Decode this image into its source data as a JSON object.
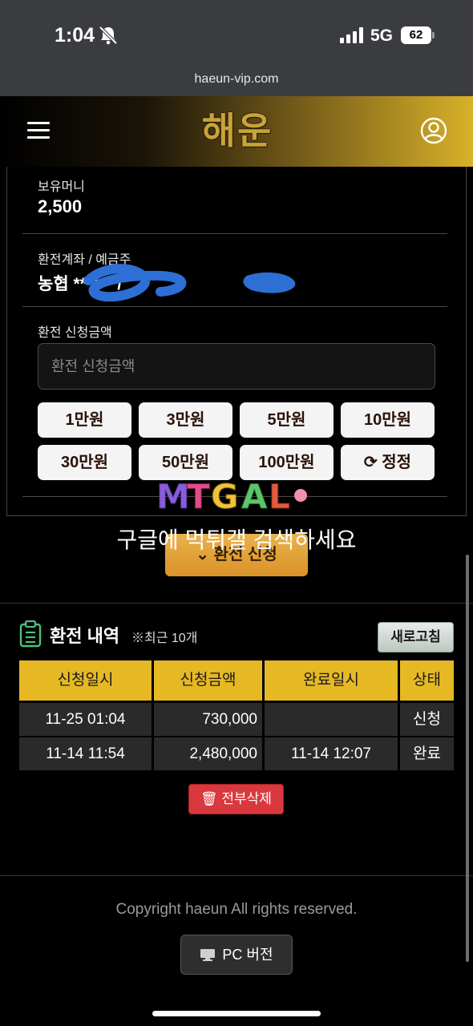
{
  "status_bar": {
    "time": "1:04",
    "network": "5G",
    "battery": "62",
    "icons": [
      "bell-slash-icon",
      "signal-icon",
      "battery-icon"
    ]
  },
  "browser": {
    "url": "haeun-vip.com"
  },
  "header": {
    "logo_text": "해운",
    "menu_icon": "hamburger-icon",
    "user_icon": "user-circle-icon",
    "accent_color": "#d9b128"
  },
  "form": {
    "balance_label": "보유머니",
    "balance_value": "2,500",
    "account_label": "환전계좌 / 예금주",
    "account_value": "농협 ****** / ",
    "amount_label": "환전 신청금액",
    "amount_placeholder": "환전 신청금액",
    "quick_amounts": [
      "1만원",
      "3만원",
      "5만원",
      "10만원",
      "30만원",
      "50만원",
      "100만원"
    ],
    "reset_label": "정정",
    "submit_label": "환전 신청"
  },
  "watermark": {
    "logo": "MTGAL",
    "text": "구글에 먹튀갤 검색하세요"
  },
  "history": {
    "title": "환전 내역",
    "note": "※최근 10개",
    "refresh_label": "새로고침",
    "columns": [
      "신청일시",
      "신청금액",
      "완료일시",
      "상태"
    ],
    "rows": [
      {
        "requested": "11-25 01:04",
        "amount": "730,000",
        "completed": "",
        "status": "신청"
      },
      {
        "requested": "11-14 11:54",
        "amount": "2,480,000",
        "completed": "11-14 12:07",
        "status": "완료"
      }
    ],
    "delete_label": "전부삭제",
    "header_color": "#e6b823",
    "delete_color": "#d9393e"
  },
  "footer": {
    "copyright": "Copyright haeun All rights reserved.",
    "pc_label": "PC 버전"
  }
}
